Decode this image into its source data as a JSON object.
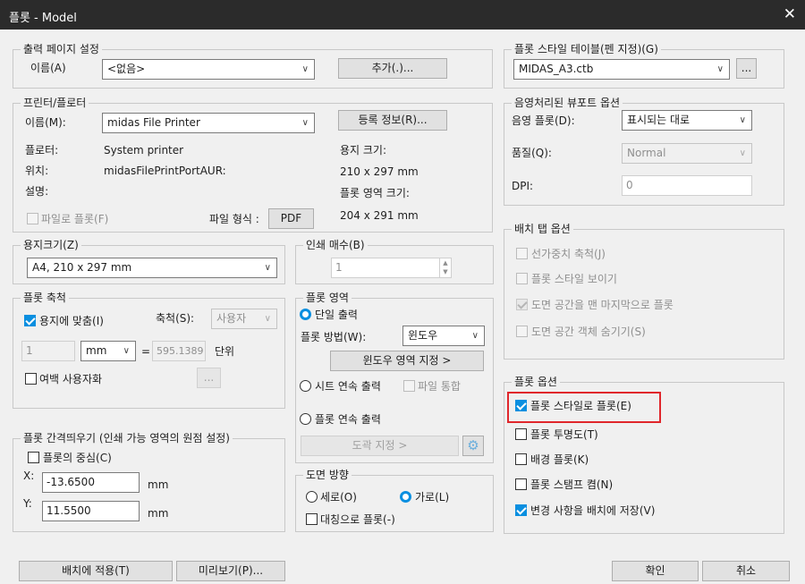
{
  "window": {
    "title": "플롯 - Model",
    "close": "✕"
  },
  "page_setup": {
    "title": "출력 페이지 설정",
    "name_label": "이름(A)",
    "name_value": "<없음>",
    "add_button": "추가(.)..."
  },
  "printer": {
    "title": "프린터/플로터",
    "name_label": "이름(M):",
    "name_value": "midas File Printer",
    "properties_button": "등록 정보(R)...",
    "plotter_label": "플로터:",
    "plotter_value": "System printer",
    "location_label": "위치:",
    "location_value": "midasFilePrintPortAUR:",
    "description_label": "설명:",
    "plot_to_file": "파일로 플롯(F)",
    "file_format_label": "파일 형식 :",
    "file_format_button": "PDF",
    "paper_size_label": "용지 크기:",
    "paper_size_value": "210 x 297 mm",
    "plot_area_size_label": "플롯 영역 크기:",
    "plot_area_size_value": "204 x 291 mm"
  },
  "paper_size": {
    "title": "용지크기(Z)",
    "value": "A4, 210 x 297 mm"
  },
  "copies": {
    "title": "인쇄 매수(B)",
    "value": "1"
  },
  "plot_scale": {
    "title": "플롯 축척",
    "fit_paper": "용지에 맞춤(I)",
    "scale_label": "축척(S):",
    "scale_value": "사용자",
    "value1": "1",
    "unit": "mm",
    "equals": "=",
    "value2": "595.1389",
    "unit_label": "단위",
    "scale_lineweights": "여백 사용자화",
    "dots_button": "..."
  },
  "plot_area": {
    "title": "플롯 영역",
    "single": "단일 출력",
    "method_label": "플롯 방법(W):",
    "method_value": "윈도우",
    "window_button": "윈도우 영역 지정 >",
    "sheet_continuous": "시트 연속 출력",
    "file_merge": "파일 통합",
    "plot_continuous": "플롯 연속 출력",
    "drawing_button": "도곽 지정 >",
    "settings_icon": "gear-icon"
  },
  "plot_offset": {
    "title": "플롯 간격띄우기 (인쇄 가능 영역의 원점 설정)",
    "center": "플롯의 중심(C)",
    "x_label": "X:",
    "x_value": "-13.6500",
    "y_label": "Y:",
    "y_value": "11.5500",
    "mm": "mm"
  },
  "orientation": {
    "title": "도면 방향",
    "portrait": "세로(O)",
    "landscape": "가로(L)",
    "upside_down": "대칭으로 플롯(-)"
  },
  "plot_style": {
    "title": "플롯 스타일 테이블(펜 지정)(G)",
    "value": "MIDAS_A3.ctb",
    "dots": "..."
  },
  "shaded": {
    "title": "음영처리된 뷰포트 옵션",
    "shade_label": "음영 플롯(D):",
    "shade_value": "표시되는 대로",
    "quality_label": "품질(Q):",
    "quality_value": "Normal",
    "dpi_label": "DPI:",
    "dpi_value": "0"
  },
  "layout_options": {
    "title": "배치 탭 옵션",
    "items": [
      "선가중치 축척(J)",
      "플롯 스타일 보이기",
      "도면 공간을 맨 마지막으로 플롯",
      "도면 공간 객체 숨기기(S)"
    ]
  },
  "plot_options": {
    "title": "플롯 옵션",
    "items": [
      "플롯 스타일로 플롯(E)",
      "플롯 투명도(T)",
      "배경 플롯(K)",
      "플롯 스탬프 켬(N)",
      "변경 사항을 배치에 저장(V)"
    ]
  },
  "bottom": {
    "apply_layout": "배치에 적용(T)",
    "preview": "미리보기(P)...",
    "ok": "확인",
    "cancel": "취소"
  },
  "colors": {
    "accent": "#0a8fe0",
    "highlight": "#e0262b",
    "titlebar": "#2b2b2b"
  }
}
